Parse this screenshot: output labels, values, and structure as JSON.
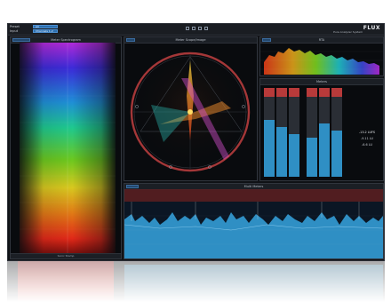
{
  "window": {
    "preset_label": "Preset",
    "input_label": "Input",
    "preset_value": "All",
    "input_value": "Channels 1-2",
    "brand": "FLUX",
    "brand_sub": "Pure Analyzer System"
  },
  "panels": {
    "spectrogram": {
      "title": "Meter Spectrogram",
      "bottom_label": "Sonic Stamp"
    },
    "scope": {
      "title": "Meter Scope/Image"
    },
    "rta": {
      "title": "RTA"
    },
    "meters": {
      "title": "Meters"
    },
    "timeline": {
      "title": "Multi Meters"
    }
  },
  "meter_readout": {
    "value1": "-13.2 LUFS",
    "value2": "-9.11 LU",
    "value3": "-6.6 LU"
  },
  "colors": {
    "accent": "#2b6fb0",
    "meter_blue": "#2f8fc4",
    "over_red": "#b83a3a"
  },
  "meter_levels": [
    0.64,
    0.56,
    0.48,
    0.44,
    0.6,
    0.52
  ],
  "icons": [
    "play-icon",
    "stop-icon",
    "settings-icon",
    "close-icon"
  ]
}
